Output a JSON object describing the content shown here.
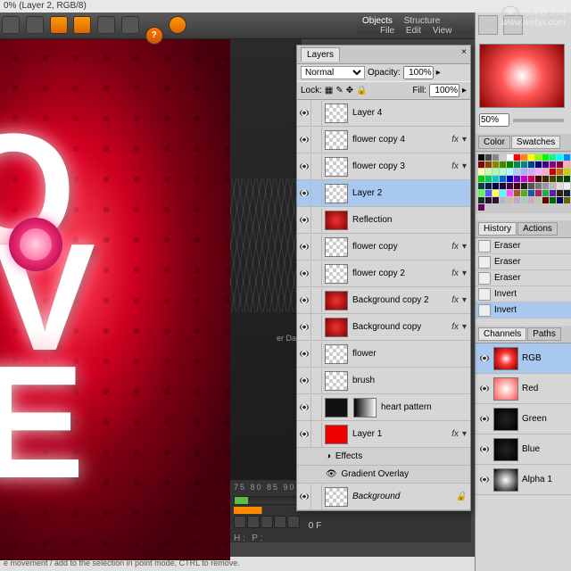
{
  "title": "0% (Layer 2, RGB/8)",
  "watermark": {
    "cn": "网页教学网",
    "url": "www.webjx.com"
  },
  "menu": {
    "objects": "Objects",
    "structure": "Structure",
    "file": "File",
    "edit": "Edit",
    "view": "View"
  },
  "layers_panel": {
    "tab": "Layers",
    "blend_mode": "Normal",
    "opacity_label": "Opacity:",
    "opacity": "100%",
    "lock_label": "Lock:",
    "fill_label": "Fill:",
    "fill": "100%",
    "effects_label": "Effects",
    "gradient_overlay": "Gradient Overlay",
    "layers": [
      {
        "name": "Layer 4",
        "thumb": "chk",
        "fx": false
      },
      {
        "name": "flower copy 4",
        "thumb": "chk",
        "fx": true
      },
      {
        "name": "flower copy 3",
        "thumb": "chk",
        "fx": true
      },
      {
        "name": "Layer 2",
        "thumb": "chk",
        "fx": false,
        "selected": true
      },
      {
        "name": "Reflection",
        "thumb": "red",
        "fx": false
      },
      {
        "name": "flower copy",
        "thumb": "chk",
        "fx": true
      },
      {
        "name": "flower copy 2",
        "thumb": "chk",
        "fx": true
      },
      {
        "name": "Background copy 2",
        "thumb": "red",
        "fx": true
      },
      {
        "name": "Background copy",
        "thumb": "red",
        "fx": true
      },
      {
        "name": "flower",
        "thumb": "chk",
        "fx": false
      },
      {
        "name": "brush",
        "thumb": "chk",
        "fx": false
      },
      {
        "name": "heart pattern",
        "thumb": "dark",
        "mask": true,
        "fx": false
      },
      {
        "name": "Layer 1",
        "thumb": "solid-red",
        "fx": true,
        "expanded": true
      },
      {
        "name": "Background",
        "thumb": "chk",
        "bg": true
      }
    ]
  },
  "zoom": "50%",
  "color_tabs": {
    "a": "Color",
    "b": "Swatches"
  },
  "history": {
    "tab": "History",
    "tab2": "Actions",
    "items": [
      "Eraser",
      "Eraser",
      "Eraser",
      "Invert",
      "Invert"
    ],
    "selected_index": 4
  },
  "channels": {
    "tab": "Channels",
    "tab2": "Paths",
    "items": [
      "RGB",
      "Red",
      "Green",
      "Blue",
      "Alpha 1"
    ],
    "selected_index": 0
  },
  "timeline": {
    "frames": "75   80   85   90",
    "F": "0 F",
    "hp": "H :",
    "pp": "P :"
  },
  "er_day": "er Day",
  "statusbar": "e movement / add to the selection in point mode, CTRL to remove.",
  "swatch_colors": [
    "#000",
    "#444",
    "#888",
    "#ccc",
    "#fff",
    "#f00",
    "#f80",
    "#ff0",
    "#8f0",
    "#0f0",
    "#0f8",
    "#0ff",
    "#08f",
    "#00f",
    "#800",
    "#840",
    "#880",
    "#480",
    "#080",
    "#084",
    "#088",
    "#048",
    "#008",
    "#408",
    "#808",
    "#804",
    "#faa",
    "#fca",
    "#ffa",
    "#cfa",
    "#afa",
    "#afc",
    "#aff",
    "#acf",
    "#aaf",
    "#caf",
    "#faf",
    "#fac",
    "#c00",
    "#c60",
    "#cc0",
    "#6c0",
    "#0c0",
    "#0c6",
    "#0cc",
    "#06c",
    "#00c",
    "#60c",
    "#c0c",
    "#c06",
    "#400",
    "#420",
    "#440",
    "#240",
    "#040",
    "#042",
    "#044",
    "#024",
    "#004",
    "#204",
    "#404",
    "#402",
    "#222",
    "#555",
    "#777",
    "#999",
    "#bbb",
    "#ddd",
    "#eee",
    "#f55",
    "#5f5",
    "#55f",
    "#ff5",
    "#5ff",
    "#f5f",
    "#a52",
    "#5a2",
    "#25a",
    "#a25",
    "#2a5",
    "#52a",
    "#321",
    "#123",
    "#231",
    "#132",
    "#213",
    "#312",
    "#abc",
    "#cba",
    "#bac",
    "#acb",
    "#cab",
    "#bca",
    "#600",
    "#060",
    "#006",
    "#660",
    "#066",
    "#606"
  ]
}
